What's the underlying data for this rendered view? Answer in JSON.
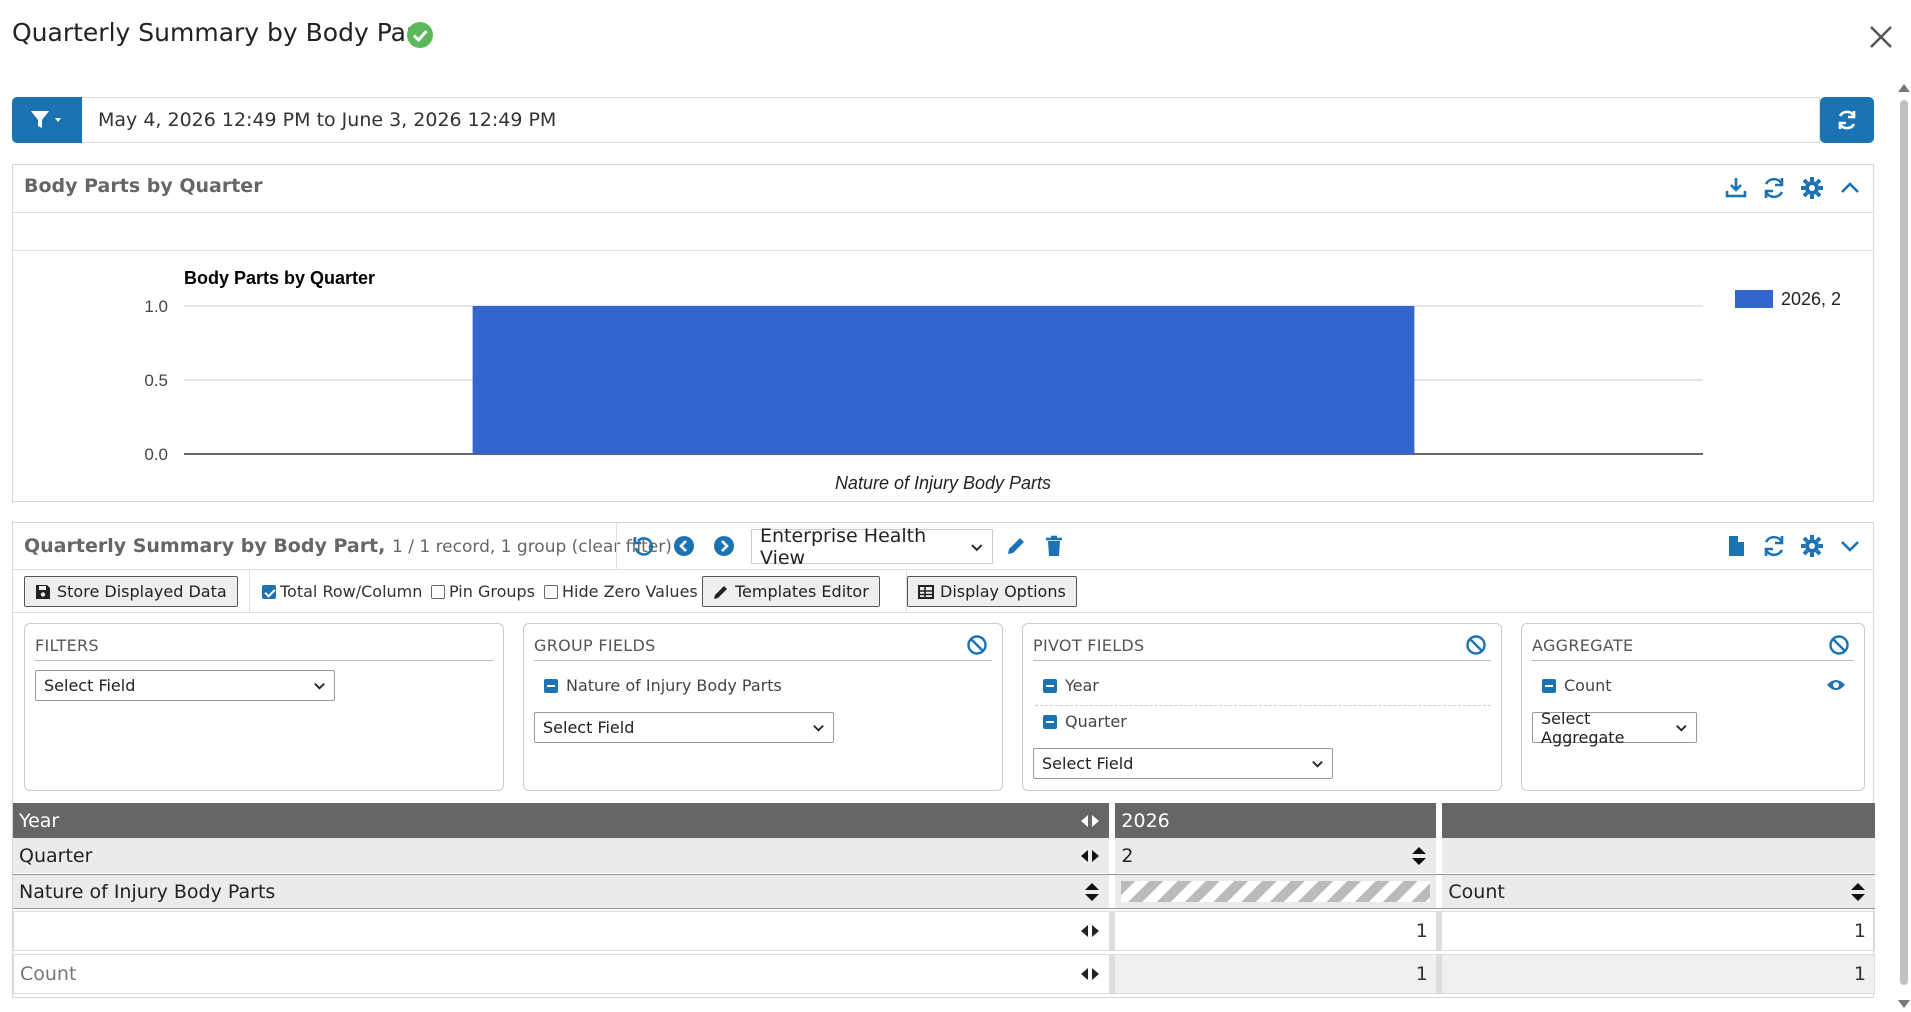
{
  "window": {
    "title": "Quarterly Summary by Body Part"
  },
  "filter_bar": {
    "date_range": "May 4, 2026 12:49 PM to June 3, 2026 12:49 PM"
  },
  "chart_panel": {
    "title": "Body Parts by Quarter"
  },
  "chart_data": {
    "type": "bar",
    "title": "Body Parts by Quarter",
    "xlabel": "Nature of Injury Body Parts",
    "ylabel": "",
    "categories": [
      ""
    ],
    "series": [
      {
        "name": "2026, 2",
        "values": [
          1
        ]
      }
    ],
    "ylim": [
      0,
      1
    ],
    "yticks": [
      "0.0",
      "0.5",
      "1.0"
    ],
    "legend": "right",
    "grid": true,
    "colors": {
      "bar": "#3366cc"
    }
  },
  "grid_panel": {
    "title": "Quarterly Summary by Body Part,",
    "meta": "1 / 1 record, 1 group (clear filter)",
    "view_select": "Enterprise Health View"
  },
  "toolbar": {
    "store_label": "Store Displayed Data",
    "total_label": "Total Row/Column",
    "pin_label": "Pin Groups",
    "hide_zero_label": "Hide Zero Values",
    "templates_label": "Templates Editor",
    "display_label": "Display Options"
  },
  "fields": {
    "filters": {
      "title": "FILTERS",
      "select": "Select Field"
    },
    "group": {
      "title": "GROUP FIELDS",
      "items": [
        "Nature of Injury Body Parts"
      ],
      "select": "Select Field"
    },
    "pivot": {
      "title": "PIVOT FIELDS",
      "items": [
        "Year",
        "Quarter"
      ],
      "select": "Select Field"
    },
    "aggregate": {
      "title": "AGGREGATE",
      "items": [
        "Count"
      ],
      "select": "Select Aggregate"
    }
  },
  "table": {
    "year_label": "Year",
    "year_value": "2026",
    "quarter_label": "Quarter",
    "quarter_value": "2",
    "group_label": "Nature of Injury Body Parts",
    "count_label": "Count",
    "row_value": "1",
    "row_total": "1",
    "total_label": "Count",
    "total_value": "1",
    "total_total": "1"
  },
  "colors": {
    "accent": "#1b73b3",
    "success": "#5cb85c"
  }
}
